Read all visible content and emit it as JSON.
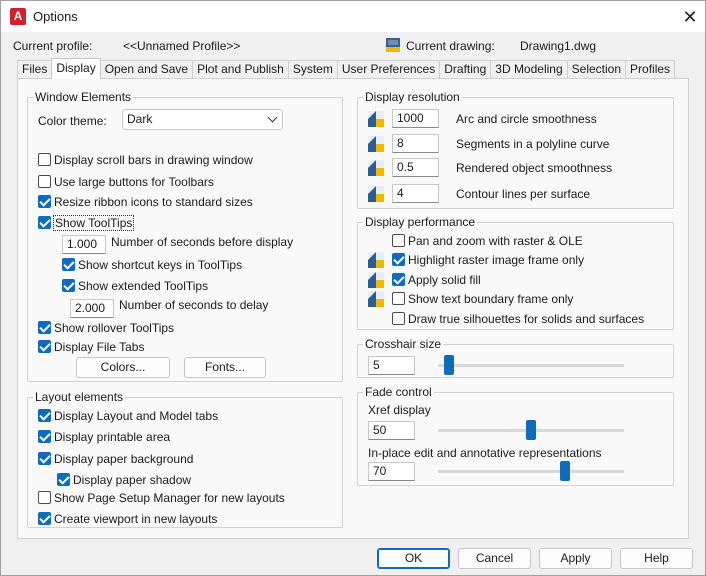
{
  "window": {
    "title": "Options",
    "app_icon_letter": "A",
    "close_glyph": "✕"
  },
  "header": {
    "current_profile_label": "Current profile:",
    "current_profile_value": "<<Unnamed Profile>>",
    "current_drawing_label": "Current drawing:",
    "current_drawing_value": "Drawing1.dwg"
  },
  "tabs": [
    "Files",
    "Display",
    "Open and Save",
    "Plot and Publish",
    "System",
    "User Preferences",
    "Drafting",
    "3D Modeling",
    "Selection",
    "Profiles"
  ],
  "active_tab": "Display",
  "window_elements": {
    "title": "Window Elements",
    "color_theme_label": "Color theme:",
    "color_theme_value": "Dark",
    "scroll_bars": "Display scroll bars in drawing window",
    "large_buttons": "Use large buttons for Toolbars",
    "resize_ribbon": "Resize ribbon icons to standard sizes",
    "show_tooltips": "Show ToolTips",
    "seconds_before_value": "1.000",
    "seconds_before_label": "Number of seconds before display",
    "shortcut_keys": "Show shortcut keys in ToolTips",
    "extended_tooltips": "Show extended ToolTips",
    "seconds_delay_value": "2.000",
    "seconds_delay_label": "Number of seconds to delay",
    "rollover_tooltips": "Show rollover ToolTips",
    "file_tabs": "Display File Tabs",
    "colors_button": "Colors...",
    "fonts_button": "Fonts..."
  },
  "layout_elements": {
    "title": "Layout elements",
    "layout_model_tabs": "Display Layout and Model tabs",
    "printable_area": "Display printable area",
    "paper_background": "Display paper background",
    "paper_shadow": "Display paper shadow",
    "page_setup_manager": "Show Page Setup Manager for new layouts",
    "create_viewport": "Create viewport in new layouts"
  },
  "display_resolution": {
    "title": "Display resolution",
    "rows": [
      {
        "value": "1000",
        "label": "Arc and circle smoothness"
      },
      {
        "value": "8",
        "label": "Segments in a polyline curve"
      },
      {
        "value": "0.5",
        "label": "Rendered object smoothness"
      },
      {
        "value": "4",
        "label": "Contour lines per surface"
      }
    ]
  },
  "display_performance": {
    "title": "Display performance",
    "pan_zoom": "Pan and zoom with raster & OLE",
    "highlight_raster": "Highlight raster image frame only",
    "apply_solid_fill": "Apply solid fill",
    "text_boundary": "Show text boundary frame only",
    "true_silhouettes": "Draw true silhouettes for solids and surfaces"
  },
  "crosshair": {
    "title": "Crosshair size",
    "value": "5",
    "slider_level": 0.02
  },
  "fade_control": {
    "title": "Fade control",
    "xref_label": "Xref display",
    "xref_value": "50",
    "xref_level": 0.5,
    "inplace_label": "In-place edit and annotative representations",
    "inplace_value": "70",
    "inplace_level": 0.7
  },
  "footer": {
    "ok": "OK",
    "cancel": "Cancel",
    "apply": "Apply",
    "help": "Help"
  },
  "colors": {
    "accent": "#0f6cbd",
    "app_icon": "#d4202a"
  }
}
